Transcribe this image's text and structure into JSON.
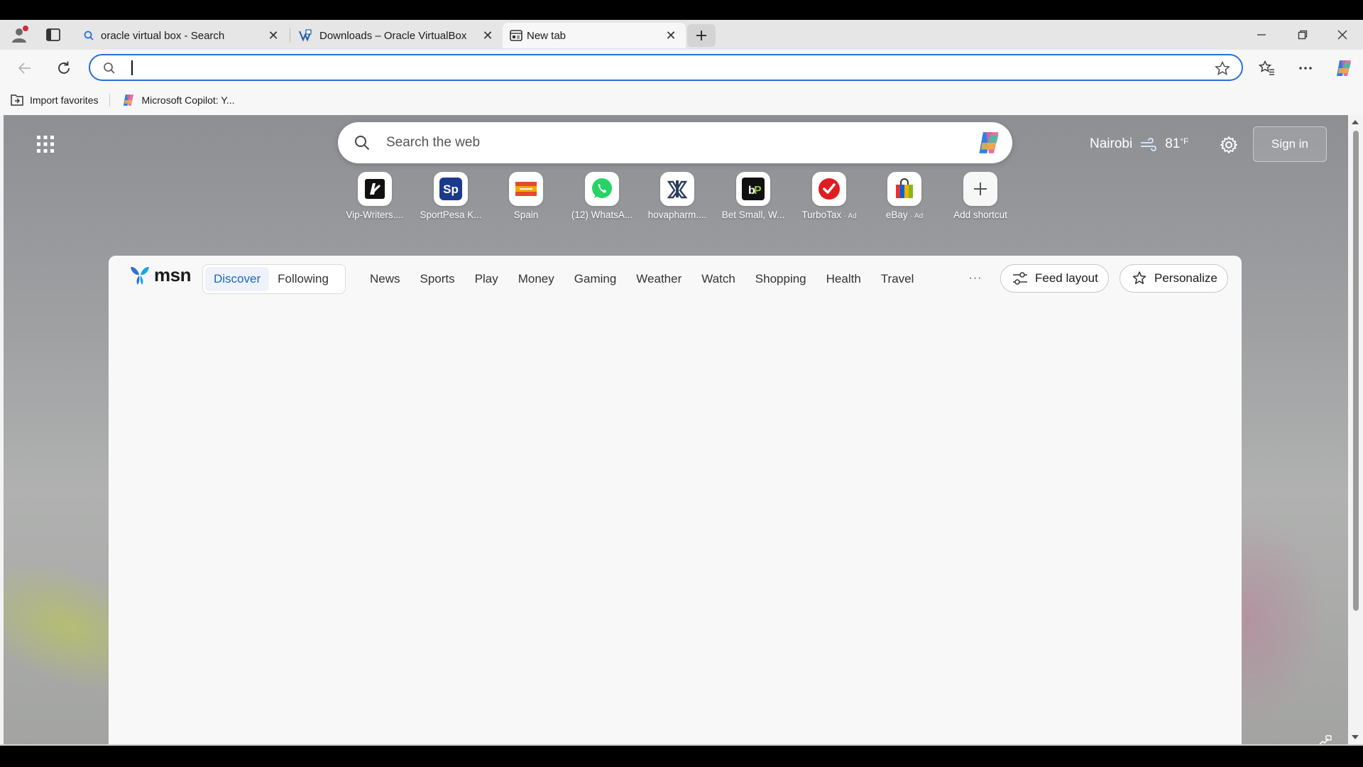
{
  "tabs": [
    {
      "title": "oracle virtual box - Search",
      "icon": "search-icon",
      "active": false
    },
    {
      "title": "Downloads – Oracle VirtualBox",
      "icon": "virtualbox-icon",
      "active": false
    },
    {
      "title": "New tab",
      "icon": "newtab-icon",
      "active": true
    }
  ],
  "toolbar": {
    "address_value": ""
  },
  "bookmarks": [
    {
      "label": "Import favorites",
      "icon": "import-icon"
    },
    {
      "label": "Microsoft Copilot: Y...",
      "icon": "copilot-icon"
    }
  ],
  "page": {
    "search_placeholder": "Search the web",
    "weather": {
      "city": "Nairobi",
      "temp": "81",
      "unit": "°F"
    },
    "sign_in": "Sign in",
    "shortcuts": [
      {
        "label": "Vip-Writers....",
        "ad": "",
        "icon": "vip-writers-icon"
      },
      {
        "label": "SportPesa K...",
        "ad": "",
        "icon": "sportpesa-icon",
        "color": "#1b3a8c"
      },
      {
        "label": "Spain",
        "ad": "",
        "icon": "spain-icon"
      },
      {
        "label": "(12) WhatsA...",
        "ad": "",
        "icon": "whatsapp-icon",
        "color": "#25d366"
      },
      {
        "label": "hovapharm....",
        "ad": "",
        "icon": "hovapharm-icon"
      },
      {
        "label": "Bet Small, W...",
        "ad": "",
        "icon": "betpawa-icon"
      },
      {
        "label": "TurboTax",
        "ad": "· Ad",
        "icon": "turbotax-icon",
        "color": "#e11b22"
      },
      {
        "label": "eBay",
        "ad": "· Ad",
        "icon": "ebay-icon"
      },
      {
        "label": "Add shortcut",
        "ad": "",
        "icon": "plus-icon"
      }
    ],
    "feed": {
      "pills": [
        "Discover",
        "Following"
      ],
      "links": [
        "News",
        "Sports",
        "Play",
        "Money",
        "Gaming",
        "Weather",
        "Watch",
        "Shopping",
        "Health",
        "Travel"
      ],
      "more": "···",
      "feed_layout": "Feed layout",
      "personalize": "Personalize",
      "brand": "msn"
    }
  },
  "colors": {
    "accent": "#2b6fd6",
    "discover_active": "#1a66c9"
  }
}
